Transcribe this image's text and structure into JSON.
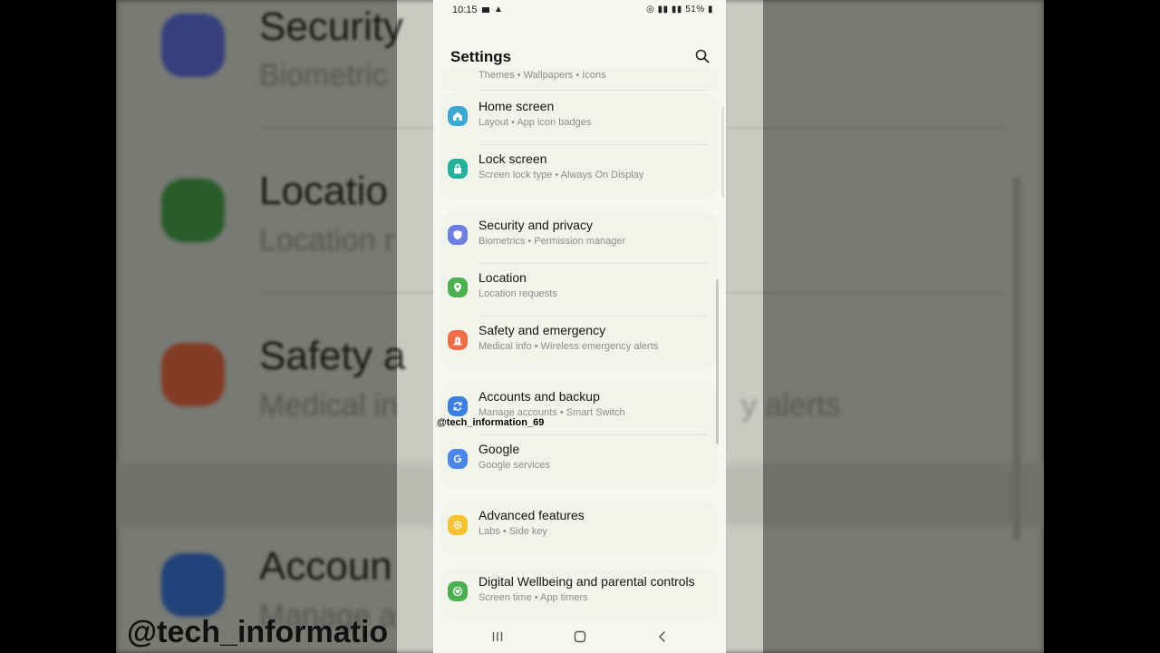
{
  "status_bar": {
    "time": "10:15",
    "right_text": "VoLTE 4G 51%",
    "battery": "51%"
  },
  "header": {
    "title": "Settings"
  },
  "partial_top_item": {
    "subtitle": "Themes  •  Wallpapers  •  Icons"
  },
  "groups": [
    {
      "items": [
        {
          "title": "Home screen",
          "subtitle": "Layout  •  App icon badges",
          "icon": "home-icon",
          "color": "#3aa9d6"
        },
        {
          "title": "Lock screen",
          "subtitle": "Screen lock type  •  Always On Display",
          "icon": "lock-icon",
          "color": "#24b09a"
        }
      ]
    },
    {
      "items": [
        {
          "title": "Security and privacy",
          "subtitle": "Biometrics  •  Permission manager",
          "icon": "shield-icon",
          "color": "#6e7fe0"
        },
        {
          "title": "Location",
          "subtitle": "Location requests",
          "icon": "location-pin-icon",
          "color": "#4caf50"
        },
        {
          "title": "Safety and emergency",
          "subtitle": "Medical info  •  Wireless emergency alerts",
          "icon": "emergency-icon",
          "color": "#ef6e4a"
        }
      ]
    },
    {
      "items": [
        {
          "title": "Accounts and backup",
          "subtitle": "Manage accounts  •  Smart Switch",
          "icon": "sync-icon",
          "color": "#3d7fe0"
        },
        {
          "title": "Google",
          "subtitle": "Google services",
          "icon": "google-icon",
          "color": "#4a86e8"
        }
      ]
    },
    {
      "items": [
        {
          "title": "Advanced features",
          "subtitle": "Labs  •  Side key",
          "icon": "gear-plus-icon",
          "color": "#f5c12e"
        }
      ]
    },
    {
      "items": [
        {
          "title": "Digital Wellbeing and parental controls",
          "subtitle": "Screen time  •  App timers",
          "icon": "wellbeing-icon",
          "color": "#4caf50"
        }
      ]
    }
  ],
  "watermark": "@tech_information_69",
  "background": {
    "titles": [
      "Security",
      "Locatio",
      "Safety a",
      "Accoun"
    ],
    "subtitles": [
      "Biometric",
      "Location r",
      "Medical in",
      "Manage a"
    ],
    "alerts_text": "y alerts",
    "watermark": "@tech_informatio"
  }
}
